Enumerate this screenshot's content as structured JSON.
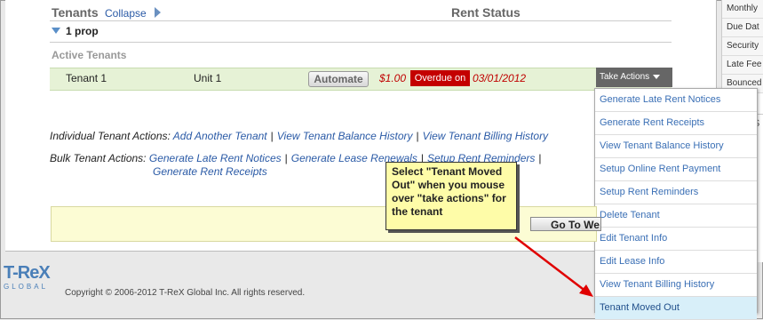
{
  "header": {
    "tenants_label": "Tenants",
    "collapse_label": "Collapse",
    "rent_status_label": "Rent Status"
  },
  "property": {
    "label": "1 prop",
    "section_label": "Active Tenants"
  },
  "tenant_row": {
    "name": "Tenant 1",
    "unit": "Unit 1",
    "automate_label": "Automate",
    "amount": "$1.00",
    "status": "Overdue on",
    "date": "03/01/2012",
    "take_actions_label": "Take Actions"
  },
  "take_actions_menu": [
    "Generate Late Rent Notices",
    "Generate Rent Receipts",
    "View Tenant Balance History",
    "Setup Online Rent Payment",
    "Setup Rent Reminders",
    "Delete Tenant",
    "Edit Tenant Info",
    "Edit Lease Info",
    "View Tenant Billing History",
    "Tenant Moved Out"
  ],
  "individual_actions": {
    "label": "Individual Tenant Actions:",
    "links": [
      "Add Another Tenant",
      "View Tenant Balance History",
      "View Tenant Billing History"
    ]
  },
  "bulk_actions": {
    "label": "Bulk Tenant Actions:",
    "links": [
      "Generate Late Rent Notices",
      "Generate Lease Renewals",
      "Setup Rent Reminders",
      "Generate Rent Receipts"
    ]
  },
  "goto_button": "Go To We",
  "callout_text": "Select \"Tenant Moved Out\" when you mouse over \"take actions\" for the tenant",
  "side_panel": [
    "Monthly",
    "Due Dat",
    "Security",
    "Late Fee",
    "Bounced"
  ],
  "side_cut_text": "S",
  "footer": {
    "logo_text": "T-ReX",
    "logo_sub": "GLOBAL",
    "copyright": "Copyright © 2006-2012 T-ReX Global Inc. All rights reserved."
  },
  "colors": {
    "overdue_bg": "#c40000",
    "row_bg": "#e6f2d6",
    "link": "#2a5aa6",
    "callout_bg": "#fefca8",
    "arrow": "#e00000"
  }
}
